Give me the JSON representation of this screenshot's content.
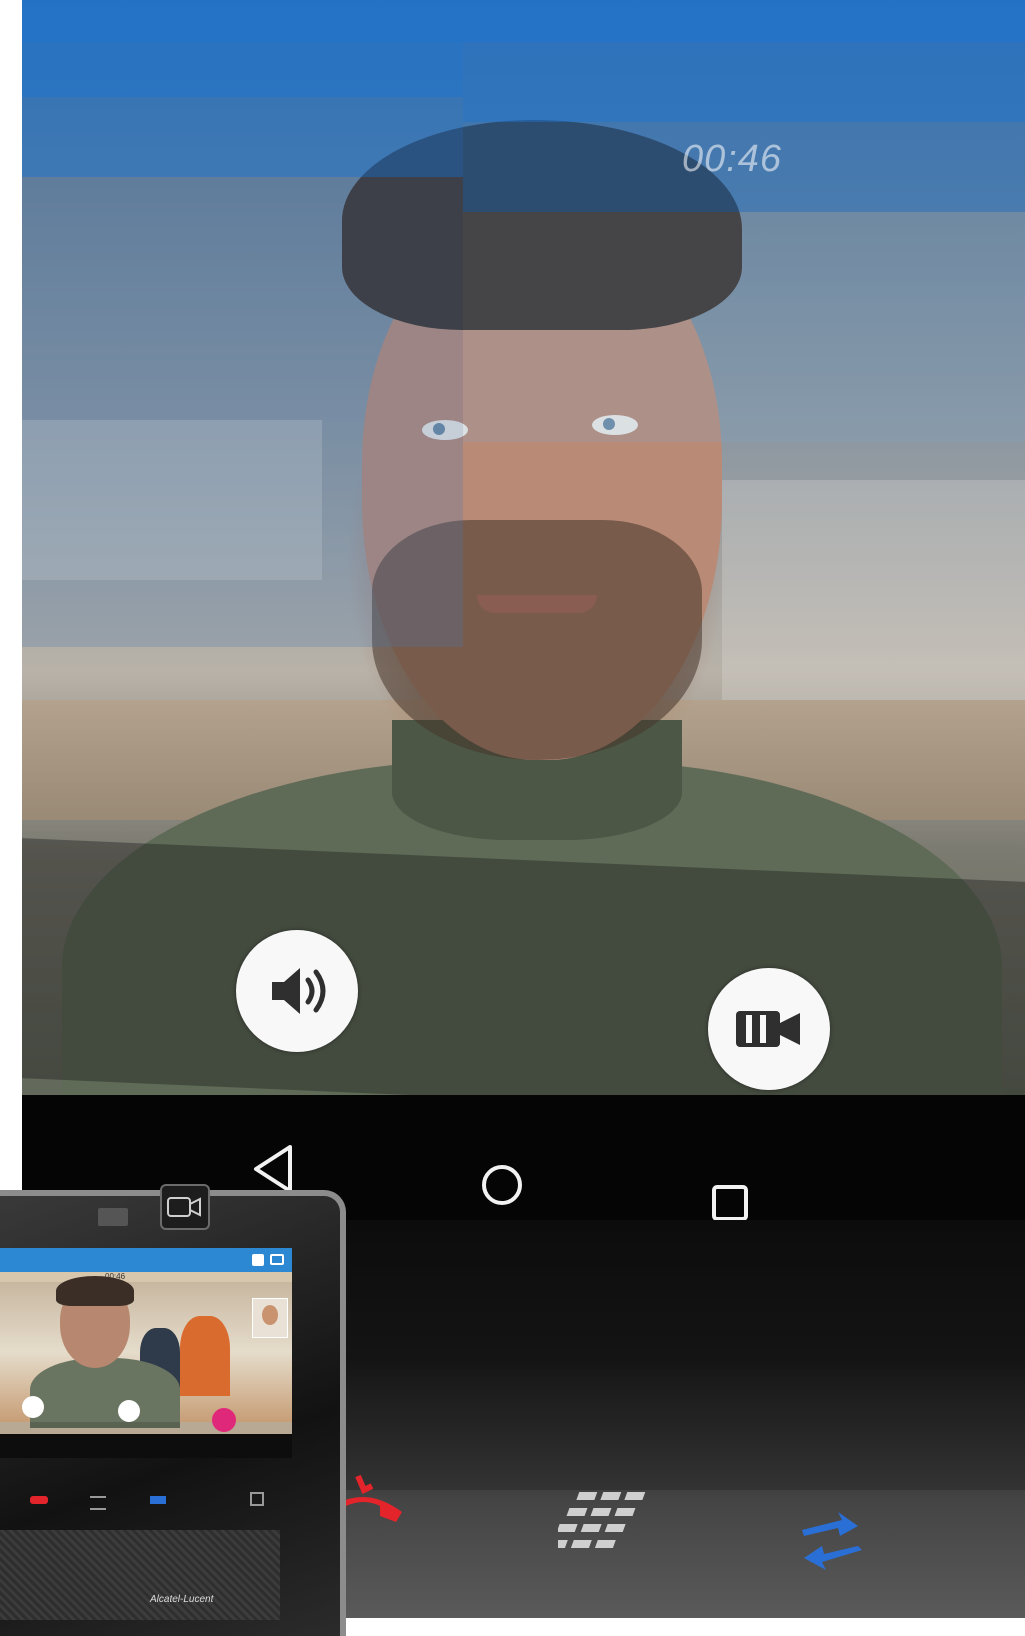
{
  "call": {
    "timer": "00:46"
  },
  "buttons": {
    "speaker": "speaker",
    "video": "video"
  },
  "nav": {
    "back": "back",
    "home": "home",
    "recents": "recents"
  },
  "mini_phone": {
    "timer": "00:46",
    "brand": "Alcatel-Lucent"
  },
  "colors": {
    "header_blue": "#1e73cd",
    "hangup_red": "#e3242b",
    "transfer_blue": "#2a6fd6",
    "mini_end_call_pink": "#e0287a"
  },
  "icons": [
    "speaker-icon",
    "video-camera-icon",
    "back-icon",
    "home-icon",
    "recents-icon",
    "hangup-icon",
    "dialpad-icon",
    "transfer-icon",
    "camera-icon",
    "chat-icon",
    "contact-icon"
  ]
}
